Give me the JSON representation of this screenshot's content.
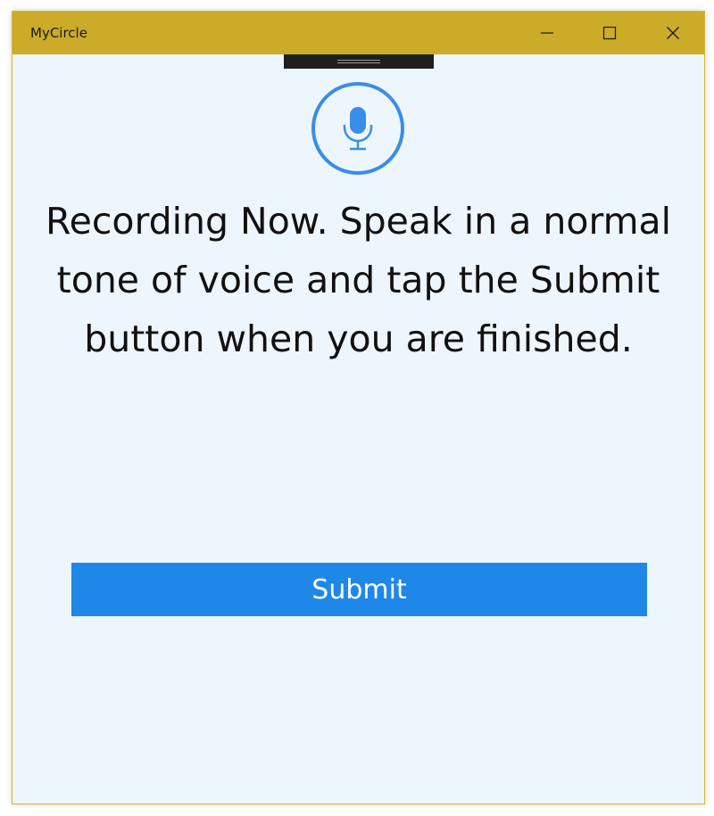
{
  "window": {
    "title": "MyCircle"
  },
  "titlebar": {
    "buttons": [
      "minimize-icon",
      "maximize-icon",
      "close-icon"
    ]
  },
  "recording": {
    "icon": "microphone-icon",
    "message": "Recording Now. Speak in a normal tone of voice and tap the Submit button when you are finished."
  },
  "actions": {
    "submit_label": "Submit"
  },
  "colors": {
    "titlebar": "#ccab29",
    "background": "#eef6fd",
    "accent": "#1f87e8",
    "mic": "#3a8de8"
  }
}
